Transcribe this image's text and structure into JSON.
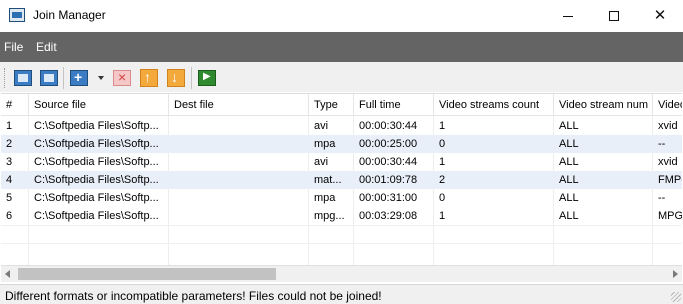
{
  "window": {
    "title": "Join Manager",
    "controls": {
      "minimize": "",
      "maximize": "",
      "close": "✕"
    }
  },
  "menu": {
    "file": "File",
    "edit": "Edit"
  },
  "toolbar": {
    "buttons": [
      {
        "name": "open-icon"
      },
      {
        "name": "browse-icon"
      },
      {
        "name": "add-icon"
      },
      {
        "name": "remove-icon"
      },
      {
        "name": "move-up-icon"
      },
      {
        "name": "move-down-icon"
      },
      {
        "name": "join-icon"
      }
    ]
  },
  "table": {
    "columns": [
      "#",
      "Source file",
      "Dest file",
      "Type",
      "Full time",
      "Video streams count",
      "Video stream num",
      "Video"
    ],
    "rows": [
      {
        "num": "1",
        "source": "C:\\Softpedia Files\\Softp...",
        "dest": "",
        "type": "avi",
        "time": "00:00:30:44",
        "vcount": "1",
        "vnum": "ALL",
        "video": "xvid"
      },
      {
        "num": "2",
        "source": "C:\\Softpedia Files\\Softp...",
        "dest": "",
        "type": "mpa",
        "time": "00:00:25:00",
        "vcount": "0",
        "vnum": "ALL",
        "video": "--"
      },
      {
        "num": "3",
        "source": "C:\\Softpedia Files\\Softp...",
        "dest": "",
        "type": "avi",
        "time": "00:00:30:44",
        "vcount": "1",
        "vnum": "ALL",
        "video": "xvid"
      },
      {
        "num": "4",
        "source": "C:\\Softpedia Files\\Softp...",
        "dest": "",
        "type": "mat...",
        "time": "00:01:09:78",
        "vcount": "2",
        "vnum": "ALL",
        "video": "FMP-"
      },
      {
        "num": "5",
        "source": "C:\\Softpedia Files\\Softp...",
        "dest": "",
        "type": "mpa",
        "time": "00:00:31:00",
        "vcount": "0",
        "vnum": "ALL",
        "video": "--"
      },
      {
        "num": "6",
        "source": "C:\\Softpedia Files\\Softp...",
        "dest": "",
        "type": "mpg...",
        "time": "00:03:29:08",
        "vcount": "1",
        "vnum": "ALL",
        "video": "MPG"
      }
    ]
  },
  "status": {
    "message": "Different formats or incompatible parameters! Files could not be joined!"
  }
}
